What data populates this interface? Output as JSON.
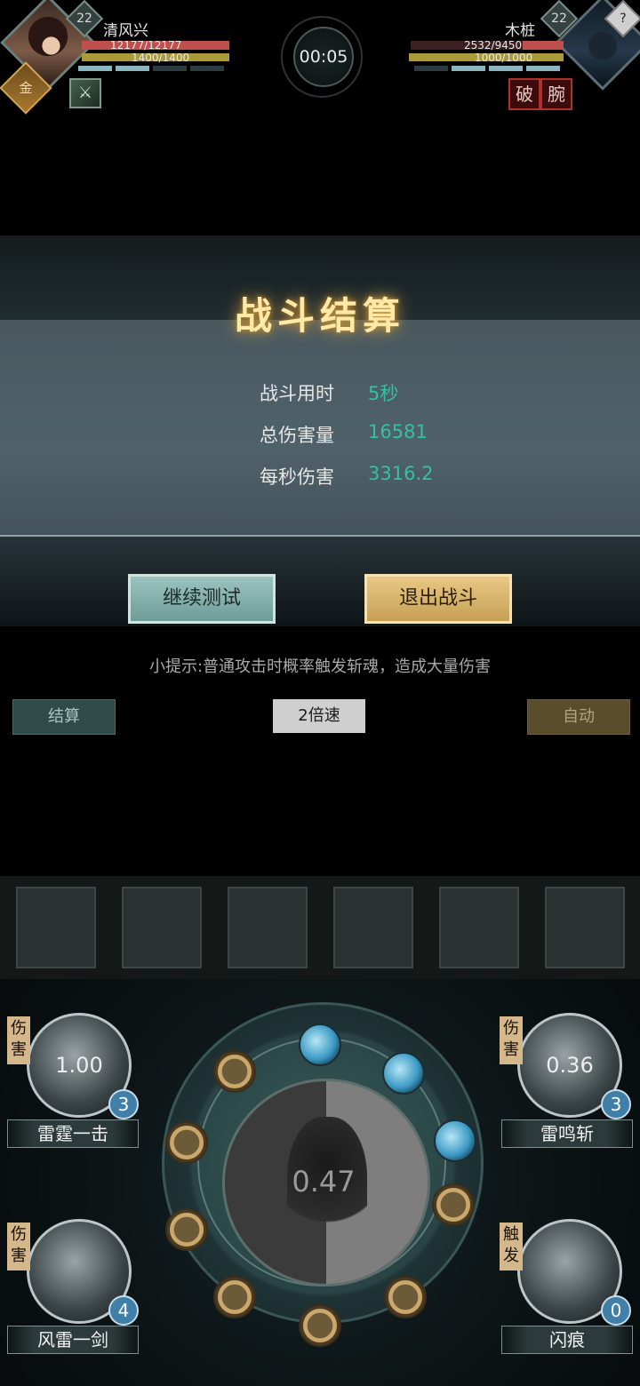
{
  "player": {
    "level": "22",
    "name": "清风兴",
    "hp_text": "12177/12177",
    "mp_text": "1400/1400",
    "rank_badge": "金",
    "buff_icon": "sword-icon"
  },
  "enemy": {
    "level": "22",
    "name": "木桩",
    "hp_text": "2532/9450",
    "mp_text": "1000/1000",
    "hp_fraction": 0.268,
    "mystery_badge": "?",
    "debuffs": [
      "破",
      "腕"
    ]
  },
  "timer": "00:05",
  "result": {
    "title": "战斗结算",
    "stats": [
      {
        "label": "战斗用时",
        "value": "5秒"
      },
      {
        "label": "总伤害量",
        "value": "16581"
      },
      {
        "label": "每秒伤害",
        "value": "3316.2"
      }
    ],
    "continue_label": "继续测试",
    "exit_label": "退出战斗"
  },
  "tip": "小提示:普通攻击时概率触发斩魂，造成大量伤害",
  "controls": {
    "settle_label": "结算",
    "speed_label": "2倍速",
    "auto_label": "自动"
  },
  "skills": [
    {
      "name": "雷霆一击",
      "tag": "伤害",
      "cooldown": "1.00",
      "count": "3"
    },
    {
      "name": "雷鸣斩",
      "tag": "伤害",
      "cooldown": "0.36",
      "count": "3"
    },
    {
      "name": "风雷一剑",
      "tag": "伤害",
      "cooldown": "",
      "count": "4"
    },
    {
      "name": "闪痕",
      "tag": "触发",
      "cooldown": "",
      "count": "0"
    }
  ],
  "main_skill": {
    "cooldown": "0.47",
    "energy_orbs_filled": 3,
    "energy_orbs_total": 12
  },
  "colors": {
    "accent_teal": "#33c2a1",
    "gold": "#d6a652",
    "hp_red": "#c0504d",
    "debuff_red": "#b03030"
  }
}
